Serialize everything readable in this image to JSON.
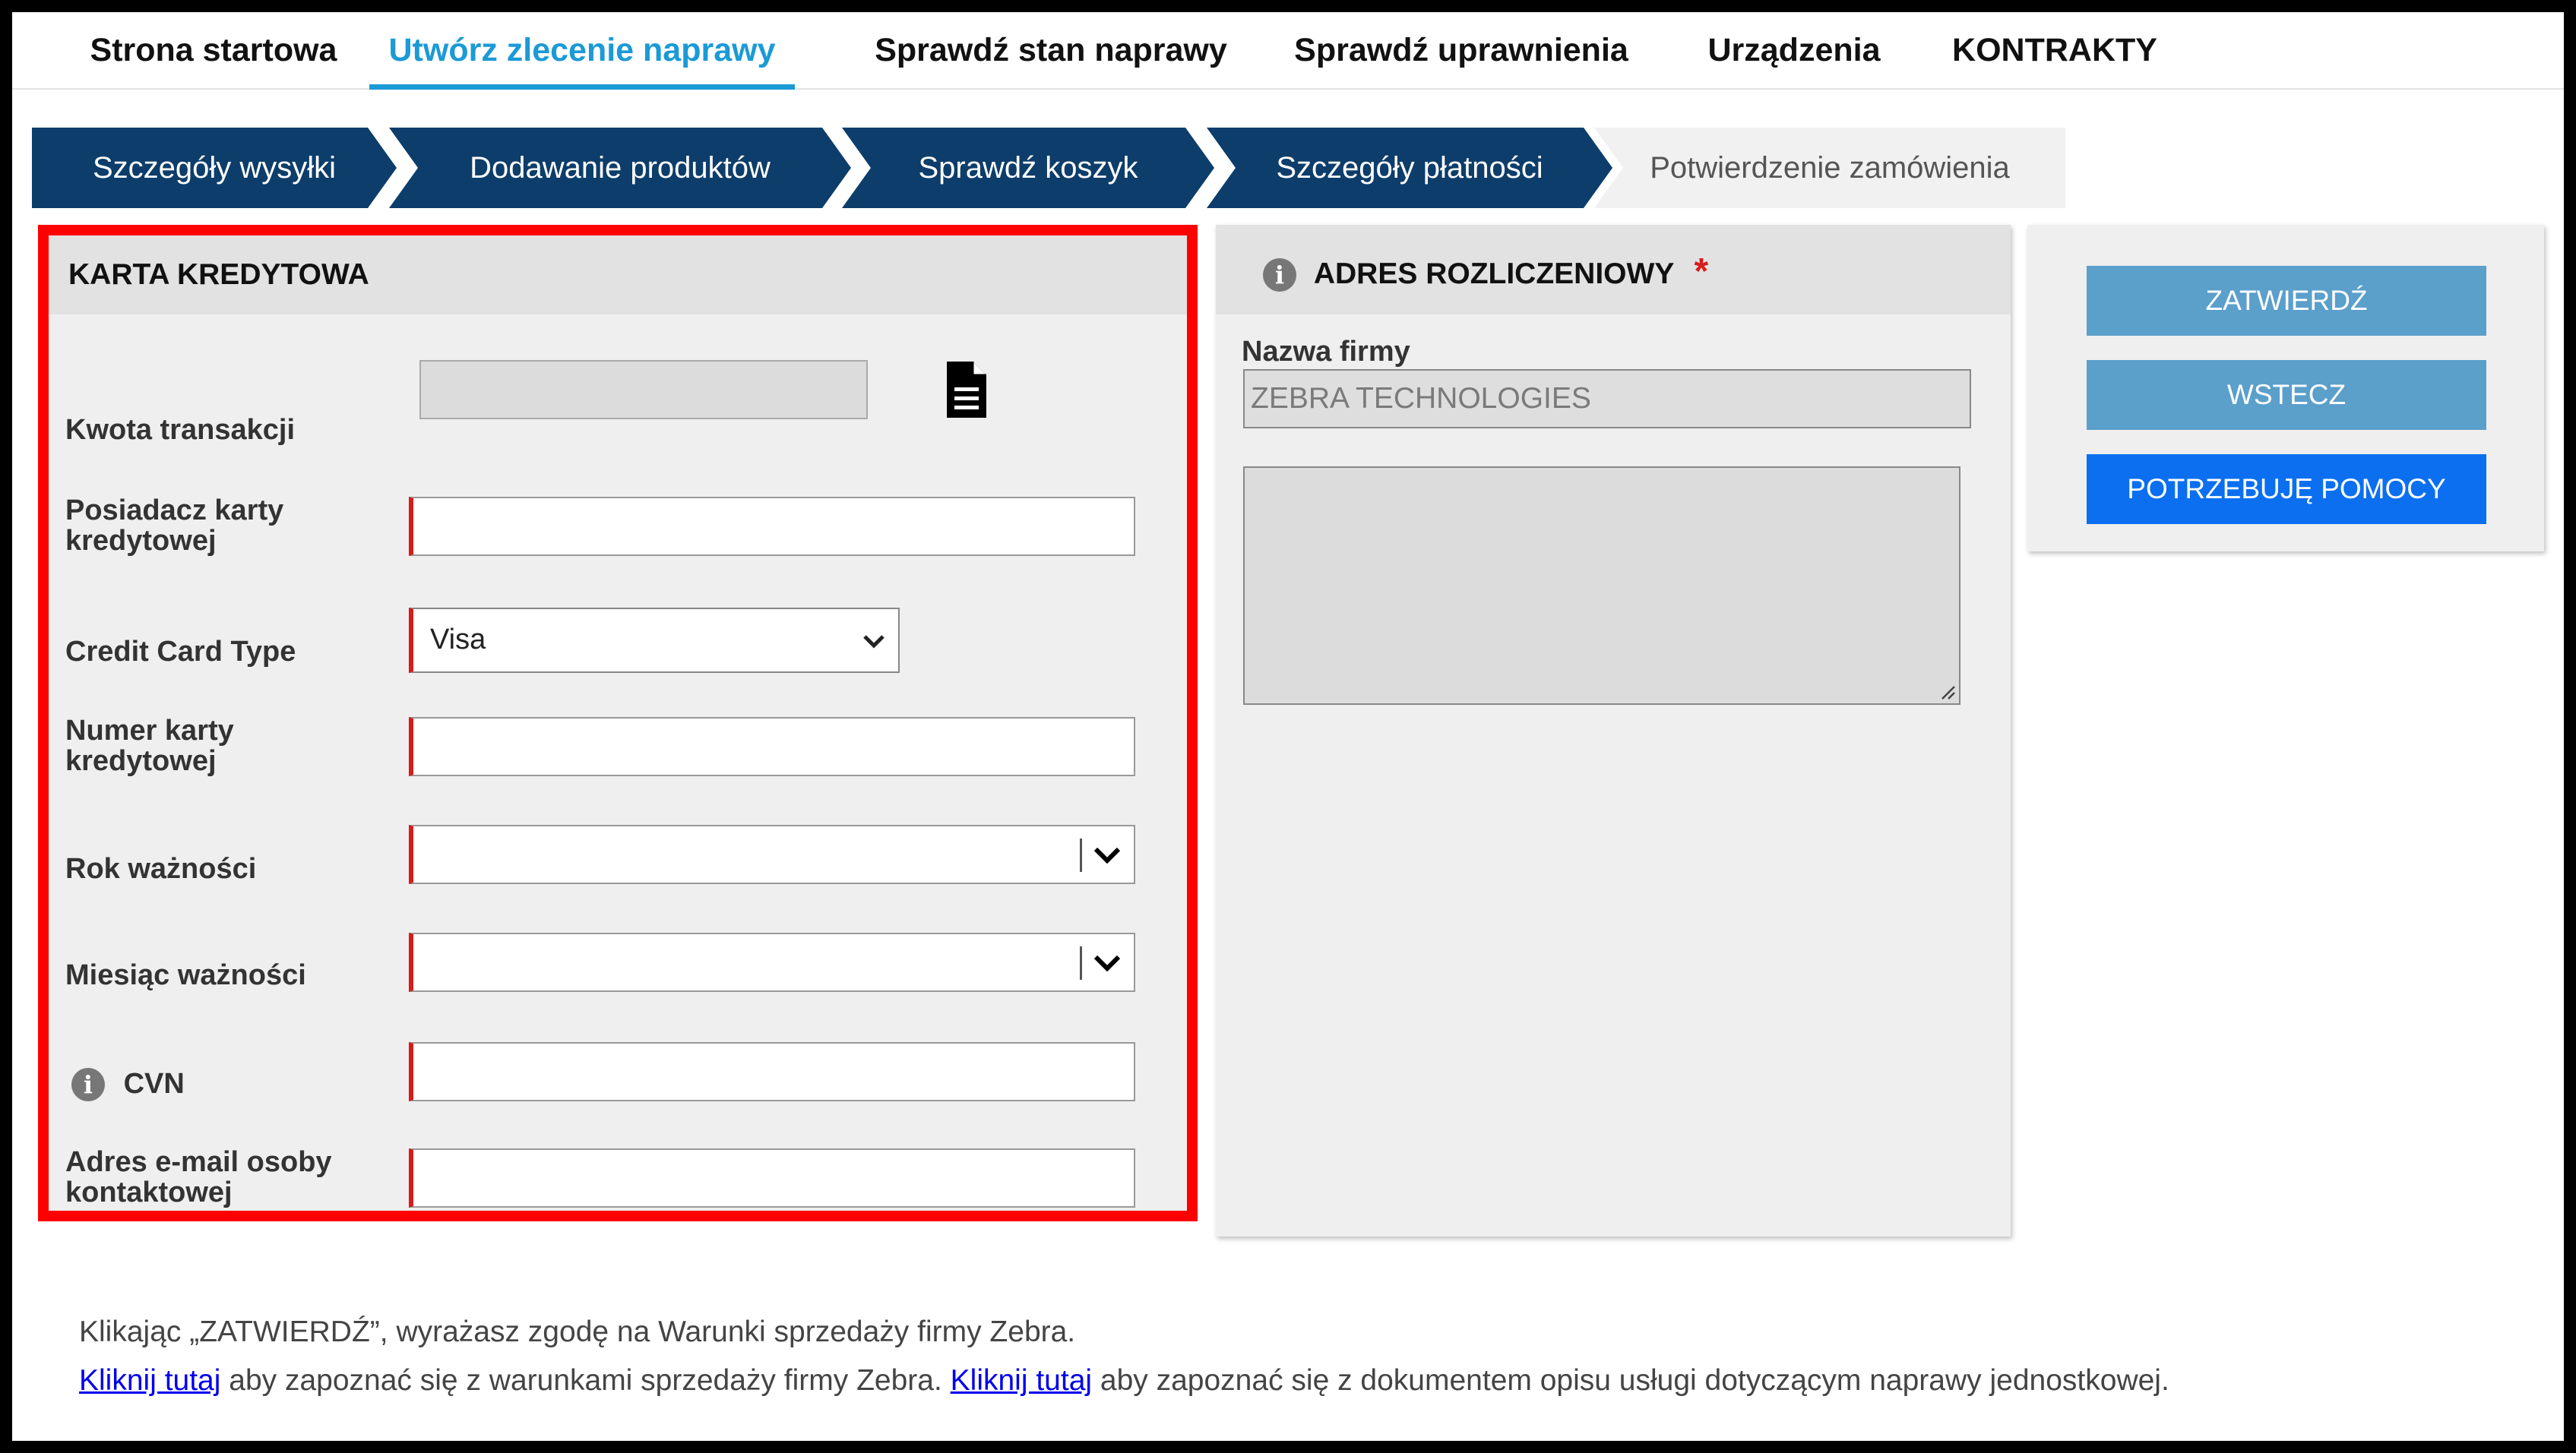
{
  "nav": {
    "tabs": [
      {
        "label": "Strona startowa"
      },
      {
        "label": "Utwórz zlecenie naprawy",
        "active": true
      },
      {
        "label": "Sprawdź stan naprawy"
      },
      {
        "label": "Sprawdź uprawnienia"
      },
      {
        "label": "Urządzenia"
      },
      {
        "label": "KONTRAKTY"
      }
    ]
  },
  "steps": [
    {
      "label": "Szczegóły wysyłki"
    },
    {
      "label": "Dodawanie produktów"
    },
    {
      "label": "Sprawdź koszyk"
    },
    {
      "label": "Szczegóły płatności"
    },
    {
      "label": "Potwierdzenie zamówienia"
    }
  ],
  "credit_card": {
    "title": "KARTA KREDYTOWA",
    "amount_label": "Kwota transakcji",
    "amount_value": "",
    "holder_label": "Posiadacz karty kredytowej",
    "holder_value": "",
    "type_label": "Credit Card Type",
    "type_value": "Visa",
    "number_label": "Numer karty kredytowej",
    "number_value": "",
    "exp_year_label": "Rok ważności",
    "exp_month_label": "Miesiąc ważności",
    "cvn_label": "CVN",
    "email_label": "Adres e-mail osoby kontaktowej",
    "email_value": ""
  },
  "billing": {
    "title": "ADRES ROZLICZENIOWY",
    "required_mark": "*",
    "company_label": "Nazwa firmy",
    "company_value": "ZEBRA TECHNOLOGIES",
    "address_value": ""
  },
  "actions": {
    "confirm": "ZATWIERDŹ",
    "back": "WSTECZ",
    "help": "POTRZEBUJĘ POMOCY"
  },
  "footer": {
    "consent": "Klikając „ZATWIERDŹ”, wyrażasz zgodę na Warunki sprzedaży firmy Zebra.",
    "link1": "Kliknij tutaj",
    "text1": " aby zapoznać się z warunkami sprzedaży firmy Zebra. ",
    "link2": "Kliknij tutaj",
    "text2": " aby zapoznać się z dokumentem opisu usługi dotyczącym naprawy jednostkowej."
  },
  "colors": {
    "nav_active": "#1b9ad6",
    "step_active": "#0d3d6a",
    "highlight_border": "#ff0000",
    "required": "#d81b1b",
    "btn_secondary": "#5b9fcb",
    "btn_primary": "#0b6ff0"
  },
  "icons": [
    "document-icon",
    "info-icon",
    "chevron-down-icon",
    "resize-grip-icon"
  ]
}
